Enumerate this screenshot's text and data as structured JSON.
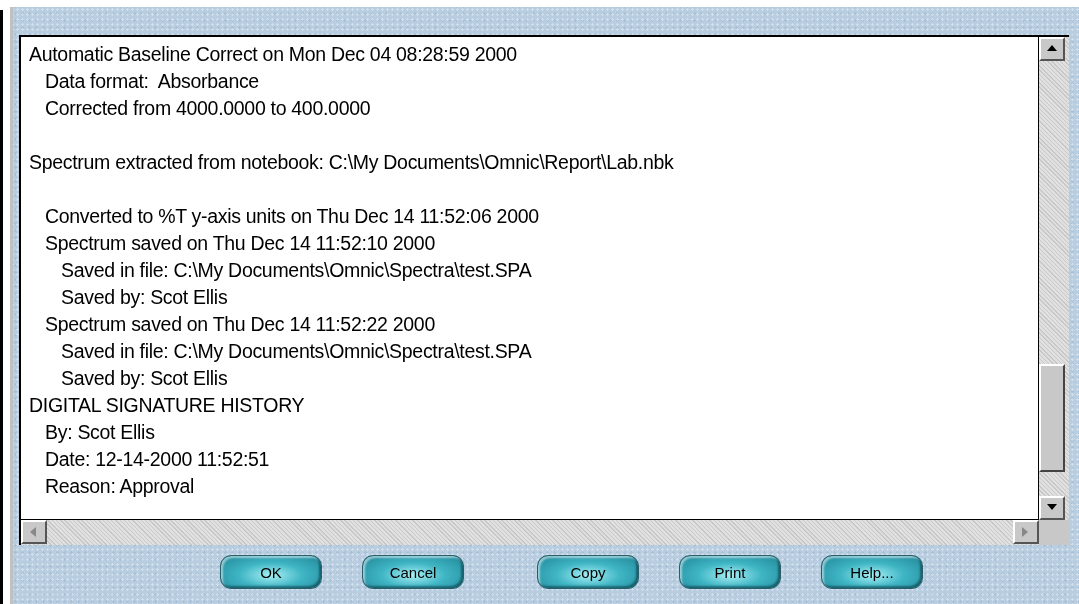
{
  "log": [
    {
      "kind": "line",
      "text": "Automatic Baseline Correct on Mon Dec 04 08:28:59 2000",
      "children": [
        {
          "kind": "line",
          "text": "Data format:  Absorbance"
        },
        {
          "kind": "line",
          "text": "Corrected from 4000.0000 to 400.0000"
        }
      ]
    },
    {
      "kind": "gap"
    },
    {
      "kind": "line",
      "text": "Spectrum extracted from notebook: C:\\My Documents\\Omnic\\Report\\Lab.nbk",
      "children": [
        {
          "kind": "gap"
        },
        {
          "kind": "line",
          "text": "Converted to %T y-axis units on Thu Dec 14 11:52:06 2000"
        },
        {
          "kind": "line",
          "text": "Spectrum saved on Thu Dec 14 11:52:10 2000",
          "children": [
            {
              "kind": "line",
              "text": "Saved in file: C:\\My Documents\\Omnic\\Spectra\\test.SPA"
            },
            {
              "kind": "line",
              "text": "Saved by: Scot Ellis"
            }
          ]
        },
        {
          "kind": "line",
          "text": "Spectrum saved on Thu Dec 14 11:52:22 2000",
          "children": [
            {
              "kind": "line",
              "text": "Saved in file: C:\\My Documents\\Omnic\\Spectra\\test.SPA"
            },
            {
              "kind": "line",
              "text": "Saved by: Scot Ellis"
            }
          ]
        }
      ]
    },
    {
      "kind": "line",
      "text": "DIGITAL SIGNATURE HISTORY",
      "children": [
        {
          "kind": "line",
          "text": "By: Scot Ellis"
        },
        {
          "kind": "line",
          "text": "Date: 12-14-2000 11:52:51"
        },
        {
          "kind": "line",
          "text": "Reason: Approval"
        }
      ]
    }
  ],
  "button_groups": [
    [
      "OK",
      "Cancel"
    ],
    [
      "Copy",
      "Print",
      "Help..."
    ]
  ]
}
